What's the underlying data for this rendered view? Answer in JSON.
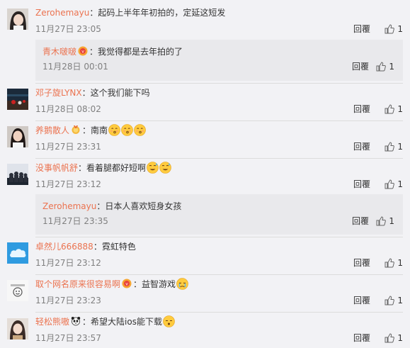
{
  "comments": [
    {
      "user": "Zerohemayu",
      "text": "：起码上半年年初拍的，定延这短发",
      "time": "11月27日 23:05",
      "reply_label": "回覆",
      "like_count": "1",
      "avatar_icon": "avatar-girl-icon",
      "sub_reply": {
        "user": "青木啵啵",
        "badge_icon": "vip-badge-icon",
        "text": "：我觉得都是去年拍的了",
        "time": "11月28日 00:01",
        "reply_label": "回覆",
        "like_count": "1"
      }
    },
    {
      "user": "邓子旋LYNX",
      "text": "：这个我们能下吗",
      "time": "11月28日 08:02",
      "reply_label": "回覆",
      "like_count": "1",
      "avatar_icon": "avatar-stadium-icon"
    },
    {
      "user": "养鹅散人",
      "badge_icon": "medal-badge-icon",
      "text": "：南南",
      "emojis": [
        "kiss-emoji-icon",
        "kiss-emoji-icon",
        "kiss-emoji-icon"
      ],
      "time": "11月27日 23:31",
      "reply_label": "回覆",
      "like_count": "1",
      "avatar_icon": "avatar-woman-icon"
    },
    {
      "user": "没事帆帆舒",
      "text": "：看着腿都好短啊",
      "emojis": [
        "sweat-emoji-icon",
        "sweat-emoji-icon"
      ],
      "time": "11月27日 23:12",
      "reply_label": "回覆",
      "like_count": "1",
      "avatar_icon": "avatar-group-icon",
      "sub_reply": {
        "user": "Zerohemayu",
        "text": "：日本人喜欢短身女孩",
        "time": "11月27日 23:35",
        "reply_label": "回覆",
        "like_count": "1"
      }
    },
    {
      "user": "卓然儿666888",
      "text": "：霓虹特色",
      "time": "11月27日 23:12",
      "reply_label": "回覆",
      "like_count": "1",
      "avatar_icon": "avatar-cloud-icon"
    },
    {
      "user": "取个网名原来很容易啊",
      "badge_icon": "vip-badge-icon",
      "text": "：益智游戏",
      "emojis": [
        "cry-emoji-icon"
      ],
      "time": "11月27日 23:23",
      "reply_label": "回覆",
      "like_count": "1",
      "avatar_icon": "avatar-sketch-icon"
    },
    {
      "user": "轻松熊嗷",
      "badge_icon": "panda-badge-icon",
      "text": "：希望大陆ios能下载",
      "emojis": [
        "sleepy-emoji-icon"
      ],
      "time": "11月27日 23:57",
      "reply_label": "回覆",
      "like_count": "1",
      "avatar_icon": "avatar-girl2-icon"
    }
  ],
  "colors": {
    "username": "#eb7350",
    "meta": "#808080",
    "background": "#f2f2f5",
    "sub_background": "#e9e9ec"
  }
}
